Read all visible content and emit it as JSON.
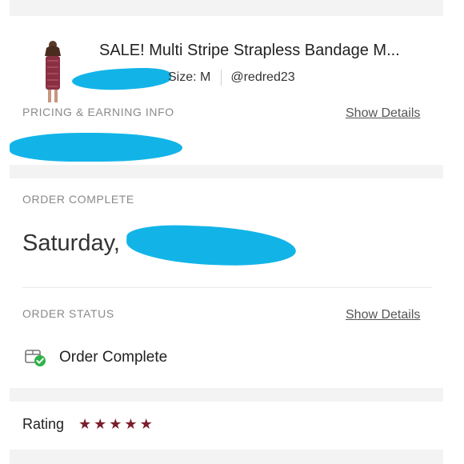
{
  "item": {
    "title": "SALE! Multi Stripe Strapless Bandage M...",
    "size": "Size: M",
    "seller": "@redred23"
  },
  "pricing_section": {
    "label": "PRICING & EARNING INFO",
    "show_details": "Show Details"
  },
  "order_complete_section": {
    "label": "ORDER COMPLETE",
    "date": "Saturday,"
  },
  "order_status_section": {
    "label": "ORDER STATUS",
    "show_details": "Show Details",
    "status": "Order Complete"
  },
  "rating": {
    "label": "Rating",
    "stars": 5,
    "star_color": "#7b1e2c"
  },
  "colors": {
    "redaction": "#12b4e8",
    "status_check": "#2fb24a",
    "dress": "#8a2f43"
  },
  "icons": {
    "status": "package-check-icon",
    "star": "star-icon"
  }
}
